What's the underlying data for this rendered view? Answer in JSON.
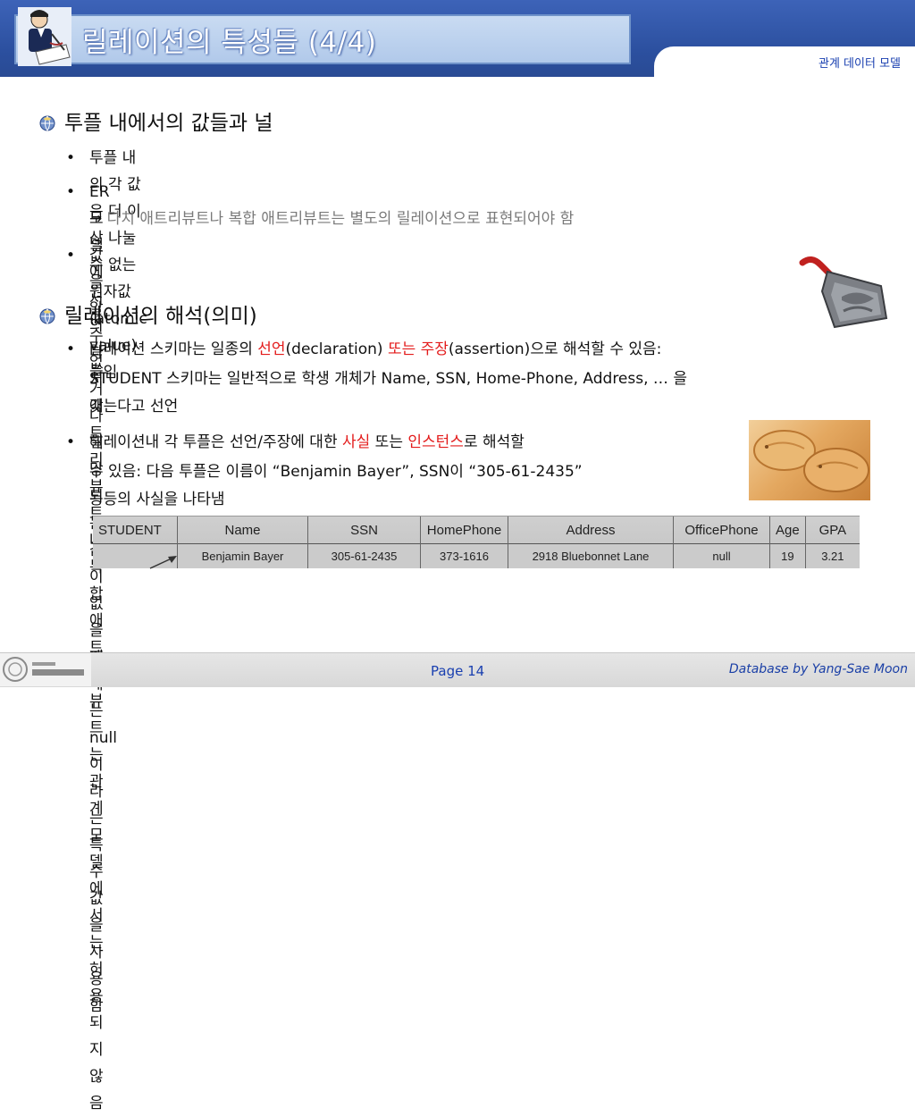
{
  "header": {
    "title": "릴레이션의 특성들 (4/4)",
    "subtitle": "관계 데이터 모델"
  },
  "section1": {
    "heading": "투플 내에서의 값들과 널",
    "bullets": [
      {
        "text": "투플 내의 각 값은 더 이상 나눌 수 없는 원자값(atomic value)들임"
      },
      {
        "text": "ER 모델에서의 다치 애트리뷰트나 복합 애트리뷰트는 관계모델에서는 허용되지 않음",
        "arrow_glyph": "→",
        "continuation": "다치 애트리뷰트나 복합 애트리뷰트는 별도의 릴레이션으로 표현되어야 함"
      },
      {
        "text": "값을 알 수 없거나 해당되는 값이 없을 때에는 null 이라는 특수 값을 사용함"
      }
    ]
  },
  "section2": {
    "heading": "릴레이션의 해석(의미)",
    "bullet1": {
      "part1": "릴레이션 스키마는 일종의 ",
      "red1": "선언",
      "part2": "(declaration) ",
      "red2": "또는 주장",
      "part3": "(assertion)으로 해석할 수 있음:",
      "line2": "STUDENT 스키마는 일반적으로 학생 개체가 Name, SSN, Home-Phone, Address, … 을",
      "line3": "갖는다고 선언"
    },
    "bullet2": {
      "part1": "릴레이션내 각 투플은  선언/주장에 대한 ",
      "red1": "사실",
      "part2": " 또는 ",
      "red2": "인스턴스",
      "part3": "로 해석할",
      "line2": "수 있음: 다음 투플은 이름이 “Benjamin Bayer”, SSN이 “305-61-2435”",
      "line3": "등등의 사실을 나타냄"
    }
  },
  "student_table": {
    "headers": [
      "STUDENT",
      "Name",
      "SSN",
      "HomePhone",
      "Address",
      "OfficePhone",
      "Age",
      "GPA"
    ],
    "row": [
      "",
      "Benjamin Bayer",
      "305-61-2435",
      "373-1616",
      "2918 Bluebonnet Lane",
      "null",
      "19",
      "3.21"
    ]
  },
  "footer": {
    "page": "Page 14",
    "credit": "Database by Yang-Sae Moon"
  },
  "colors": {
    "header_blue": "#2b4f9e",
    "title_box": "#b9cfee",
    "red_highlight": "#e31b1b",
    "gray_text": "#7a7a7a",
    "footer_text": "#1a40b0"
  }
}
